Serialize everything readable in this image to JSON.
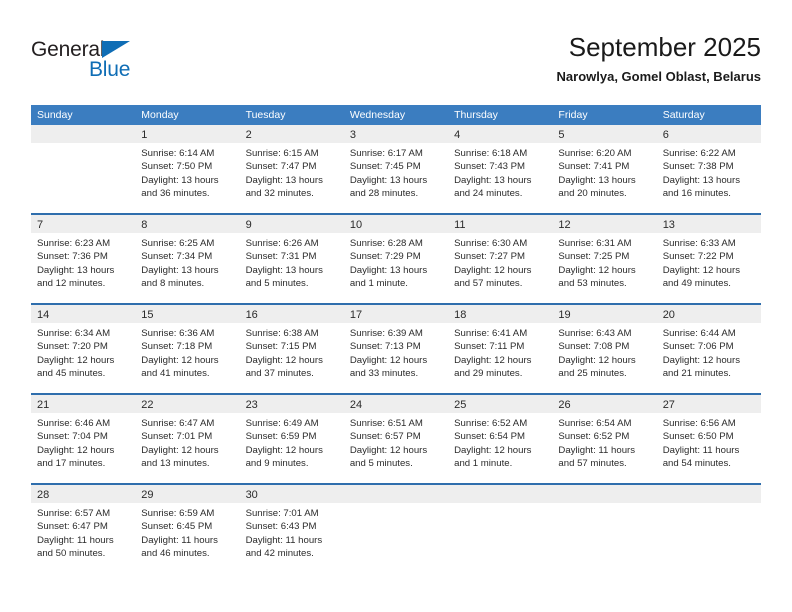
{
  "brand": {
    "word_one": "General",
    "word_two": "Blue",
    "accent_color": "#0f6db5"
  },
  "header": {
    "title": "September 2025",
    "subtitle": "Narowlya, Gomel Oblast, Belarus"
  },
  "theme": {
    "header_bar_color": "#3b7dc0",
    "week_divider_color": "#2f6ead",
    "day_number_bar_color": "#eeeeee"
  },
  "calendar": {
    "weekday_headers": [
      "Sunday",
      "Monday",
      "Tuesday",
      "Wednesday",
      "Thursday",
      "Friday",
      "Saturday"
    ],
    "weeks": [
      [
        {
          "day": "",
          "lines": []
        },
        {
          "day": "1",
          "lines": [
            "Sunrise: 6:14 AM",
            "Sunset: 7:50 PM",
            "Daylight: 13 hours",
            "and 36 minutes."
          ]
        },
        {
          "day": "2",
          "lines": [
            "Sunrise: 6:15 AM",
            "Sunset: 7:47 PM",
            "Daylight: 13 hours",
            "and 32 minutes."
          ]
        },
        {
          "day": "3",
          "lines": [
            "Sunrise: 6:17 AM",
            "Sunset: 7:45 PM",
            "Daylight: 13 hours",
            "and 28 minutes."
          ]
        },
        {
          "day": "4",
          "lines": [
            "Sunrise: 6:18 AM",
            "Sunset: 7:43 PM",
            "Daylight: 13 hours",
            "and 24 minutes."
          ]
        },
        {
          "day": "5",
          "lines": [
            "Sunrise: 6:20 AM",
            "Sunset: 7:41 PM",
            "Daylight: 13 hours",
            "and 20 minutes."
          ]
        },
        {
          "day": "6",
          "lines": [
            "Sunrise: 6:22 AM",
            "Sunset: 7:38 PM",
            "Daylight: 13 hours",
            "and 16 minutes."
          ]
        }
      ],
      [
        {
          "day": "7",
          "lines": [
            "Sunrise: 6:23 AM",
            "Sunset: 7:36 PM",
            "Daylight: 13 hours",
            "and 12 minutes."
          ]
        },
        {
          "day": "8",
          "lines": [
            "Sunrise: 6:25 AM",
            "Sunset: 7:34 PM",
            "Daylight: 13 hours",
            "and 8 minutes."
          ]
        },
        {
          "day": "9",
          "lines": [
            "Sunrise: 6:26 AM",
            "Sunset: 7:31 PM",
            "Daylight: 13 hours",
            "and 5 minutes."
          ]
        },
        {
          "day": "10",
          "lines": [
            "Sunrise: 6:28 AM",
            "Sunset: 7:29 PM",
            "Daylight: 13 hours",
            "and 1 minute."
          ]
        },
        {
          "day": "11",
          "lines": [
            "Sunrise: 6:30 AM",
            "Sunset: 7:27 PM",
            "Daylight: 12 hours",
            "and 57 minutes."
          ]
        },
        {
          "day": "12",
          "lines": [
            "Sunrise: 6:31 AM",
            "Sunset: 7:25 PM",
            "Daylight: 12 hours",
            "and 53 minutes."
          ]
        },
        {
          "day": "13",
          "lines": [
            "Sunrise: 6:33 AM",
            "Sunset: 7:22 PM",
            "Daylight: 12 hours",
            "and 49 minutes."
          ]
        }
      ],
      [
        {
          "day": "14",
          "lines": [
            "Sunrise: 6:34 AM",
            "Sunset: 7:20 PM",
            "Daylight: 12 hours",
            "and 45 minutes."
          ]
        },
        {
          "day": "15",
          "lines": [
            "Sunrise: 6:36 AM",
            "Sunset: 7:18 PM",
            "Daylight: 12 hours",
            "and 41 minutes."
          ]
        },
        {
          "day": "16",
          "lines": [
            "Sunrise: 6:38 AM",
            "Sunset: 7:15 PM",
            "Daylight: 12 hours",
            "and 37 minutes."
          ]
        },
        {
          "day": "17",
          "lines": [
            "Sunrise: 6:39 AM",
            "Sunset: 7:13 PM",
            "Daylight: 12 hours",
            "and 33 minutes."
          ]
        },
        {
          "day": "18",
          "lines": [
            "Sunrise: 6:41 AM",
            "Sunset: 7:11 PM",
            "Daylight: 12 hours",
            "and 29 minutes."
          ]
        },
        {
          "day": "19",
          "lines": [
            "Sunrise: 6:43 AM",
            "Sunset: 7:08 PM",
            "Daylight: 12 hours",
            "and 25 minutes."
          ]
        },
        {
          "day": "20",
          "lines": [
            "Sunrise: 6:44 AM",
            "Sunset: 7:06 PM",
            "Daylight: 12 hours",
            "and 21 minutes."
          ]
        }
      ],
      [
        {
          "day": "21",
          "lines": [
            "Sunrise: 6:46 AM",
            "Sunset: 7:04 PM",
            "Daylight: 12 hours",
            "and 17 minutes."
          ]
        },
        {
          "day": "22",
          "lines": [
            "Sunrise: 6:47 AM",
            "Sunset: 7:01 PM",
            "Daylight: 12 hours",
            "and 13 minutes."
          ]
        },
        {
          "day": "23",
          "lines": [
            "Sunrise: 6:49 AM",
            "Sunset: 6:59 PM",
            "Daylight: 12 hours",
            "and 9 minutes."
          ]
        },
        {
          "day": "24",
          "lines": [
            "Sunrise: 6:51 AM",
            "Sunset: 6:57 PM",
            "Daylight: 12 hours",
            "and 5 minutes."
          ]
        },
        {
          "day": "25",
          "lines": [
            "Sunrise: 6:52 AM",
            "Sunset: 6:54 PM",
            "Daylight: 12 hours",
            "and 1 minute."
          ]
        },
        {
          "day": "26",
          "lines": [
            "Sunrise: 6:54 AM",
            "Sunset: 6:52 PM",
            "Daylight: 11 hours",
            "and 57 minutes."
          ]
        },
        {
          "day": "27",
          "lines": [
            "Sunrise: 6:56 AM",
            "Sunset: 6:50 PM",
            "Daylight: 11 hours",
            "and 54 minutes."
          ]
        }
      ],
      [
        {
          "day": "28",
          "lines": [
            "Sunrise: 6:57 AM",
            "Sunset: 6:47 PM",
            "Daylight: 11 hours",
            "and 50 minutes."
          ]
        },
        {
          "day": "29",
          "lines": [
            "Sunrise: 6:59 AM",
            "Sunset: 6:45 PM",
            "Daylight: 11 hours",
            "and 46 minutes."
          ]
        },
        {
          "day": "30",
          "lines": [
            "Sunrise: 7:01 AM",
            "Sunset: 6:43 PM",
            "Daylight: 11 hours",
            "and 42 minutes."
          ]
        },
        {
          "day": "",
          "lines": []
        },
        {
          "day": "",
          "lines": []
        },
        {
          "day": "",
          "lines": []
        },
        {
          "day": "",
          "lines": []
        }
      ]
    ]
  }
}
